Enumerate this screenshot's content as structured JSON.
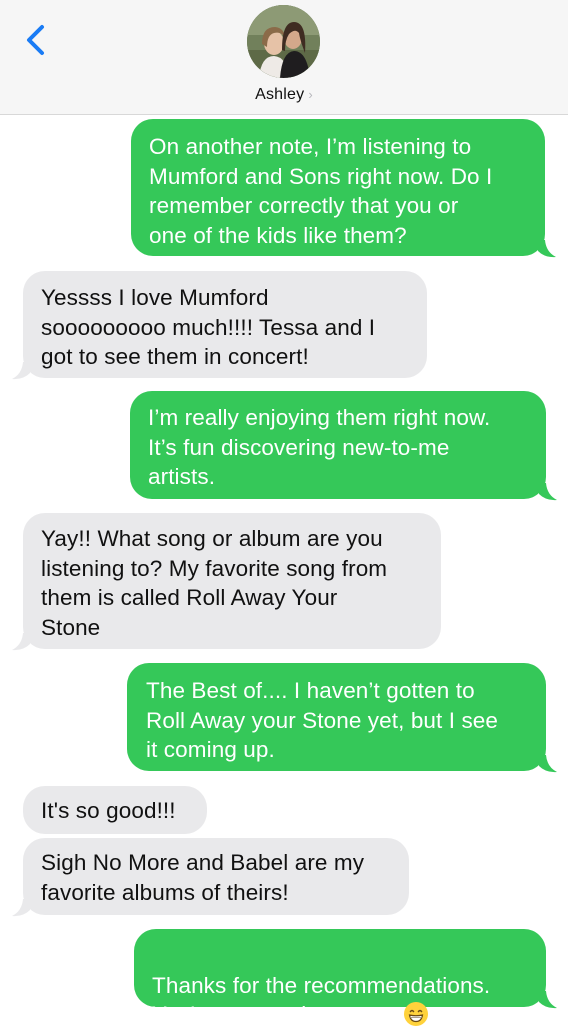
{
  "header": {
    "contact_name": "Ashley",
    "chevron": "›",
    "back_icon": "chevron-left-icon",
    "accent": "#1a7cf5"
  },
  "colors": {
    "outgoing": "#35c859",
    "incoming": "#e9e9eb"
  },
  "messages": [
    {
      "direction": "outgoing",
      "text": "On another note, I’m listening to\nMumford and Sons right now. Do I\nremember correctly that you or\none of the kids like them?"
    },
    {
      "direction": "incoming",
      "text": "Yessss I love Mumford\nsooooooooo much!!!! Tessa and I\ngot to see them in concert!"
    },
    {
      "direction": "outgoing",
      "text": "I’m really enjoying them right now.\nIt’s fun discovering new-to-me\nartists."
    },
    {
      "direction": "incoming",
      "text": "Yay!! What song or album are you\nlistening to? My favorite song from\nthem is called Roll Away Your\nStone"
    },
    {
      "direction": "outgoing",
      "text": "The Best of.... I haven’t gotten to\nRoll Away your Stone yet, but I see\nit coming up."
    },
    {
      "direction": "incoming",
      "text": "It's so good!!!"
    },
    {
      "direction": "incoming",
      "text": "Sigh No More and Babel are my\nfavorite albums of theirs!"
    },
    {
      "direction": "outgoing",
      "text": "Thanks for the recommendations.\nYou’re my music mentor.",
      "emoji": "grinning-face-icon"
    }
  ]
}
